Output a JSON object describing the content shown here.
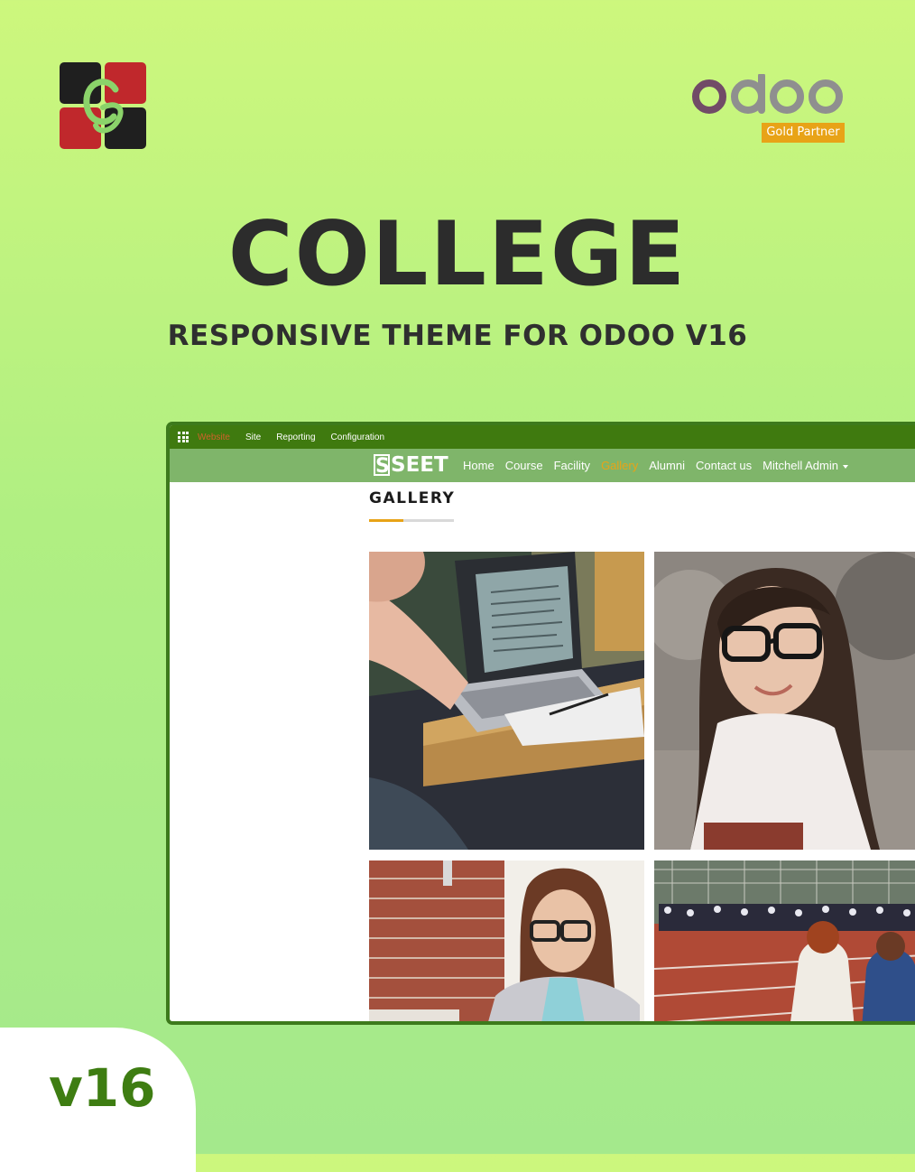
{
  "brand": {
    "logo_icon": "cg-monogram-icon",
    "colors": {
      "red": "#c0282c",
      "dark": "#1f1f1f"
    }
  },
  "partner": {
    "logo_text": "odoo",
    "badge": "Gold Partner",
    "colors": {
      "purple": "#714b67",
      "grey": "#8f8f8f",
      "gold": "#e8a317"
    }
  },
  "hero": {
    "title": "COLLEGE",
    "subtitle": "RESPONSIVE THEME FOR ODOO V16"
  },
  "odoo_bar": {
    "apps_icon": "grid-apps-icon",
    "items": [
      {
        "label": "Website",
        "active": true
      },
      {
        "label": "Site"
      },
      {
        "label": "Reporting"
      },
      {
        "label": "Configuration"
      }
    ]
  },
  "site": {
    "logo_letter": "S",
    "logo_text": "SEET",
    "nav": [
      {
        "label": "Home"
      },
      {
        "label": "Course"
      },
      {
        "label": "Facility"
      },
      {
        "label": "Gallery",
        "active": true
      },
      {
        "label": "Alumni"
      },
      {
        "label": "Contact us"
      },
      {
        "label": "Mitchell Admin"
      }
    ],
    "colors": {
      "nav_bg": "#7fb56a",
      "bar_bg": "#3f7a0f",
      "accent": "#e8a317"
    }
  },
  "gallery": {
    "heading": "GALLERY",
    "photos": [
      "laptop-desk-photo",
      "student-glasses-photo",
      "woman-reading-photo",
      "running-track-photo"
    ]
  },
  "version": "v16"
}
